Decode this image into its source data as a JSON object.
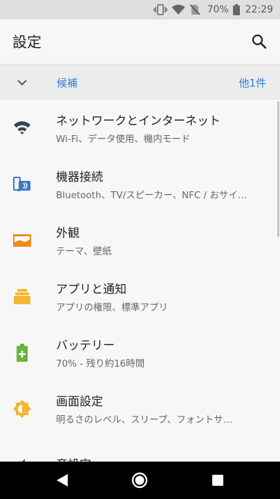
{
  "status_bar": {
    "battery_percent": "70%",
    "time": "22:29"
  },
  "app_bar": {
    "title": "設定",
    "search_icon": "search-icon"
  },
  "suggestions": {
    "label": "候補",
    "more": "他1件"
  },
  "settings_items": [
    {
      "title": "ネットワークとインターネット",
      "summary": "Wi-Fi、データ使用、機内モード",
      "icon": "wifi-icon",
      "color": "#37474f"
    },
    {
      "title": "機器接続",
      "summary": "Bluetooth、TV/スピーカー、NFC / おサイ…",
      "icon": "devices-icon",
      "color": "#3a78c2"
    },
    {
      "title": "外観",
      "summary": "テーマ、壁紙",
      "icon": "wallpaper-icon",
      "color": "#f08a1c"
    },
    {
      "title": "アプリと通知",
      "summary": "アプリの権限、標準アプリ",
      "icon": "apps-icon",
      "color": "#f5b731"
    },
    {
      "title": "バッテリー",
      "summary": "70% - 残り約16時間",
      "icon": "battery-icon",
      "color": "#6ab23e"
    },
    {
      "title": "画面設定",
      "summary": "明るさのレベル、スリープ、フォントサ…",
      "icon": "brightness-icon",
      "color": "#f5b731"
    },
    {
      "title": "音設定",
      "summary": "",
      "icon": "sound-icon",
      "color": "#5b3e9c"
    }
  ],
  "colors": {
    "accent": "#2f7bd6",
    "background": "#f7f7f7",
    "suggest_bg": "#ececec"
  }
}
